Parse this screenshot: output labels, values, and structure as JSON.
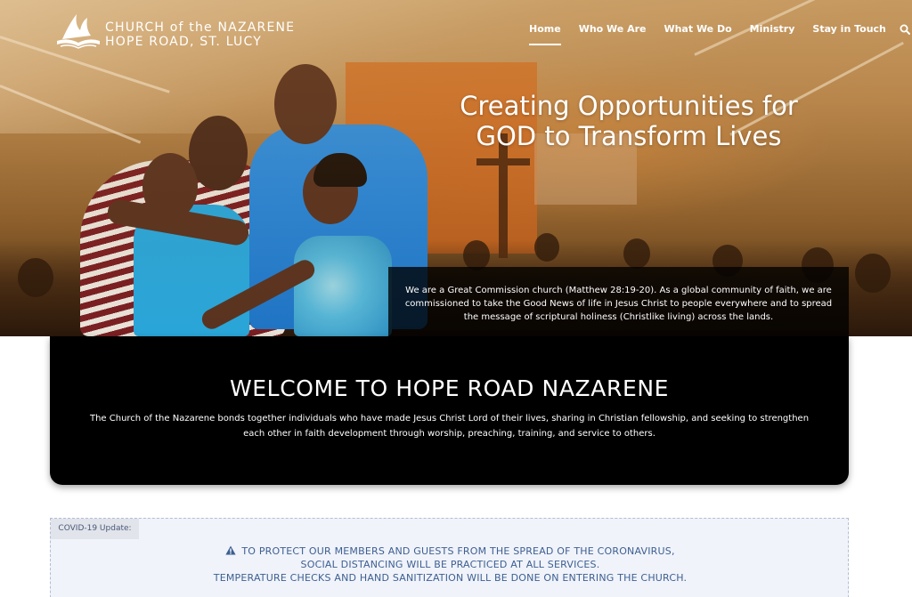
{
  "brand": {
    "line1": "CHURCH of the NAZARENE",
    "line2": "HOPE ROAD, ST. LUCY",
    "logo_icon": "flame-book-icon"
  },
  "nav": {
    "items": [
      "Home",
      "Who We Are",
      "What We Do",
      "Ministry",
      "Stay in Touch"
    ],
    "active": "Home",
    "search_icon": "search-icon"
  },
  "hero": {
    "title_line1": "Creating Opportunities for",
    "title_line2": "GOD to Transform Lives",
    "mission": "We are a Great Commission church (Matthew 28:19-20). As a global community of faith, we are commissioned to take the Good News of life in Jesus Christ to people everywhere and to spread the message of scriptural holiness (Christlike living) across the lands."
  },
  "welcome": {
    "heading": "WELCOME TO HOPE ROAD NAZARENE",
    "body": "The Church of the Nazarene bonds together individuals who have made Jesus Christ Lord of their lives, sharing in Christian fellowship, and seeking to strengthen each other in faith development through worship, preaching, training, and service to others."
  },
  "covid": {
    "tab_label": "COVID-19 Update:",
    "line1": "TO PROTECT OUR MEMBERS AND GUESTS FROM THE SPREAD OF THE CORONAVIRUS,",
    "line2": "SOCIAL DISTANCING WILL BE PRACTICED AT ALL SERVICES.",
    "line3": "TEMPERATURE CHECKS AND HAND SANITIZATION WILL BE DONE ON ENTERING THE CHURCH.",
    "icon": "warning-icon"
  },
  "colors": {
    "hero_gold": "#b9884f",
    "welcome_bg": "#000000",
    "covid_text": "#3d5f91",
    "covid_bg": "#f0f3fa"
  }
}
